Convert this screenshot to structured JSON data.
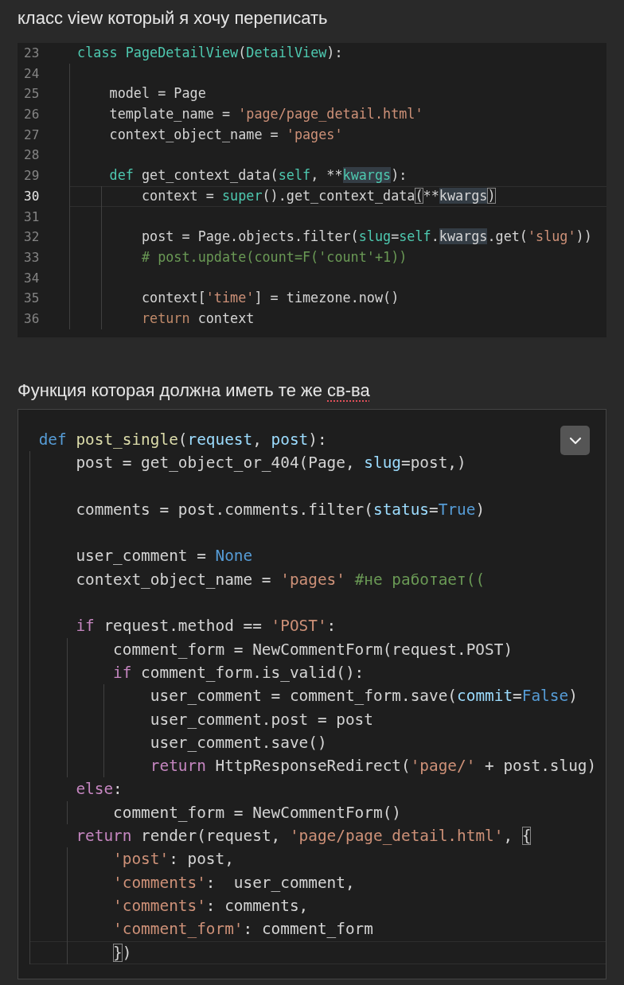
{
  "heading_1": "класс view который я хочу переписать",
  "code_block_1": {
    "lines": [
      {
        "number": "23",
        "active": false,
        "tokens": [
          {
            "text": "class",
            "kind": "storage"
          },
          {
            "text": " PageDetailView",
            "kind": "storage"
          },
          {
            "text": "(",
            "kind": "plain"
          },
          {
            "text": "DetailView",
            "kind": "storage"
          },
          {
            "text": "):",
            "kind": "plain"
          }
        ]
      },
      {
        "number": "24",
        "active": false
      },
      {
        "number": "25",
        "active": false,
        "tokens": [
          {
            "text": "    model = Page",
            "kind": "plain"
          }
        ]
      },
      {
        "number": "26",
        "active": false,
        "tokens": [
          {
            "text": "    template_name = ",
            "kind": "plain"
          },
          {
            "text": "'page/page_detail.html'",
            "kind": "string"
          }
        ]
      },
      {
        "number": "27",
        "active": false,
        "tokens": [
          {
            "text": "    context_object_name = ",
            "kind": "plain"
          },
          {
            "text": "'pages'",
            "kind": "string"
          }
        ]
      },
      {
        "number": "28",
        "active": false
      },
      {
        "number": "29",
        "active": false,
        "tokens": [
          {
            "text": "    def",
            "kind": "storage"
          },
          {
            "text": " get_context_data(",
            "kind": "plain"
          },
          {
            "text": "self",
            "kind": "storage"
          },
          {
            "text": ", **",
            "kind": "plain"
          },
          {
            "text": "kwargs",
            "kind": "storage",
            "word_match": true
          },
          {
            "text": "):",
            "kind": "plain"
          }
        ]
      },
      {
        "number": "30",
        "active": true,
        "tokens": [
          {
            "text": "        context = ",
            "kind": "plain"
          },
          {
            "text": "super",
            "kind": "storage"
          },
          {
            "text": "().get_context_data",
            "kind": "plain"
          },
          {
            "text": "(",
            "kind": "plain",
            "bracket_match": true
          },
          {
            "text": "**",
            "kind": "plain"
          },
          {
            "text": "kwargs",
            "kind": "plain",
            "word_match": true
          },
          {
            "text": ")",
            "kind": "plain",
            "bracket_match": true
          }
        ]
      },
      {
        "number": "31",
        "active": false
      },
      {
        "number": "32",
        "active": false,
        "tokens": [
          {
            "text": "        post = Page.objects.filter(",
            "kind": "plain"
          },
          {
            "text": "slug",
            "kind": "storage"
          },
          {
            "text": "=",
            "kind": "plain"
          },
          {
            "text": "self",
            "kind": "storage"
          },
          {
            "text": ".",
            "kind": "plain"
          },
          {
            "text": "kwargs",
            "kind": "plain",
            "word_match": true
          },
          {
            "text": ".get(",
            "kind": "plain"
          },
          {
            "text": "'slug'",
            "kind": "string"
          },
          {
            "text": "))",
            "kind": "plain"
          }
        ]
      },
      {
        "number": "33",
        "active": false,
        "tokens": [
          {
            "text": "        # post.update(count=F('count'+1))",
            "kind": "comment"
          }
        ]
      },
      {
        "number": "34",
        "active": false
      },
      {
        "number": "35",
        "active": false,
        "tokens": [
          {
            "text": "        context[",
            "kind": "plain"
          },
          {
            "text": "'time'",
            "kind": "string"
          },
          {
            "text": "] = timezone.now()",
            "kind": "plain"
          }
        ]
      },
      {
        "number": "36",
        "active": false,
        "tokens": [
          {
            "text": "        return",
            "kind": "return"
          },
          {
            "text": " context",
            "kind": "plain"
          }
        ]
      }
    ]
  },
  "heading_2": [
    {
      "text": "Функция которая должна иметь те же ",
      "misspelled": false
    },
    {
      "text": "св-ва",
      "misspelled": true
    }
  ],
  "code_block_2": {
    "lines": [
      {
        "active": false,
        "tokens": [
          {
            "text": "def",
            "kind": "keyword"
          },
          {
            "text": " post_single",
            "kind": "function"
          },
          {
            "text": "(",
            "kind": "plain"
          },
          {
            "text": "request",
            "kind": "param"
          },
          {
            "text": ", ",
            "kind": "plain"
          },
          {
            "text": "post",
            "kind": "param"
          },
          {
            "text": "):",
            "kind": "plain"
          }
        ]
      },
      {
        "active": false,
        "tokens": [
          {
            "text": "    post = get_object_or_404(Page, ",
            "kind": "plain"
          },
          {
            "text": "slug",
            "kind": "param"
          },
          {
            "text": "=post,)",
            "kind": "plain"
          }
        ]
      },
      {
        "active": false
      },
      {
        "active": false,
        "tokens": [
          {
            "text": "    comments = post.comments.filter(",
            "kind": "plain"
          },
          {
            "text": "status",
            "kind": "param"
          },
          {
            "text": "=",
            "kind": "plain"
          },
          {
            "text": "True",
            "kind": "keyword"
          },
          {
            "text": ")",
            "kind": "plain"
          }
        ]
      },
      {
        "active": false
      },
      {
        "active": false,
        "tokens": [
          {
            "text": "    user_comment = ",
            "kind": "plain"
          },
          {
            "text": "None",
            "kind": "keyword"
          }
        ]
      },
      {
        "active": false,
        "tokens": [
          {
            "text": "    context_object_name = ",
            "kind": "plain"
          },
          {
            "text": "'pages'",
            "kind": "string"
          },
          {
            "text": " #не работает((",
            "kind": "comment"
          }
        ]
      },
      {
        "active": false
      },
      {
        "active": false,
        "tokens": [
          {
            "text": "    if",
            "kind": "control"
          },
          {
            "text": " request.method == ",
            "kind": "plain"
          },
          {
            "text": "'POST'",
            "kind": "string"
          },
          {
            "text": ":",
            "kind": "plain"
          }
        ]
      },
      {
        "active": false,
        "tokens": [
          {
            "text": "        comment_form = NewCommentForm(request.POST)",
            "kind": "plain"
          }
        ]
      },
      {
        "active": false,
        "tokens": [
          {
            "text": "        if",
            "kind": "control"
          },
          {
            "text": " comment_form.is_valid():",
            "kind": "plain"
          }
        ]
      },
      {
        "active": false,
        "tokens": [
          {
            "text": "            user_comment = comment_form.save(",
            "kind": "plain"
          },
          {
            "text": "commit",
            "kind": "param"
          },
          {
            "text": "=",
            "kind": "plain"
          },
          {
            "text": "False",
            "kind": "keyword"
          },
          {
            "text": ")",
            "kind": "plain"
          }
        ]
      },
      {
        "active": false,
        "tokens": [
          {
            "text": "            user_comment.post = post",
            "kind": "plain"
          }
        ]
      },
      {
        "active": false,
        "tokens": [
          {
            "text": "            user_comment.save()",
            "kind": "plain"
          }
        ]
      },
      {
        "active": false,
        "tokens": [
          {
            "text": "            return",
            "kind": "control"
          },
          {
            "text": " HttpResponseRedirect(",
            "kind": "plain"
          },
          {
            "text": "'page/'",
            "kind": "string"
          },
          {
            "text": " + post.slug)",
            "kind": "plain"
          }
        ]
      },
      {
        "active": false,
        "tokens": [
          {
            "text": "    else",
            "kind": "control"
          },
          {
            "text": ":",
            "kind": "plain"
          }
        ]
      },
      {
        "active": false,
        "tokens": [
          {
            "text": "        comment_form = NewCommentForm()",
            "kind": "plain"
          }
        ]
      },
      {
        "active": false,
        "tokens": [
          {
            "text": "    return",
            "kind": "control"
          },
          {
            "text": " render(request, ",
            "kind": "plain"
          },
          {
            "text": "'page/page_detail.html'",
            "kind": "string"
          },
          {
            "text": ", ",
            "kind": "plain"
          },
          {
            "text": "{",
            "kind": "plain",
            "bracket_match": true
          }
        ]
      },
      {
        "active": false,
        "tokens": [
          {
            "text": "        'post'",
            "kind": "string"
          },
          {
            "text": ": post,",
            "kind": "plain"
          }
        ]
      },
      {
        "active": false,
        "tokens": [
          {
            "text": "        'comments'",
            "kind": "string"
          },
          {
            "text": ":  user_comment,",
            "kind": "plain"
          }
        ]
      },
      {
        "active": false,
        "tokens": [
          {
            "text": "        'comments'",
            "kind": "string"
          },
          {
            "text": ": comments,",
            "kind": "plain"
          }
        ]
      },
      {
        "active": false,
        "tokens": [
          {
            "text": "        'comment_form'",
            "kind": "string"
          },
          {
            "text": ": comment_form",
            "kind": "plain"
          }
        ]
      },
      {
        "active": true,
        "tokens": [
          {
            "text": "        }",
            "kind": "plain",
            "bracket_match": true
          },
          {
            "text": ")",
            "kind": "plain"
          }
        ]
      }
    ]
  }
}
